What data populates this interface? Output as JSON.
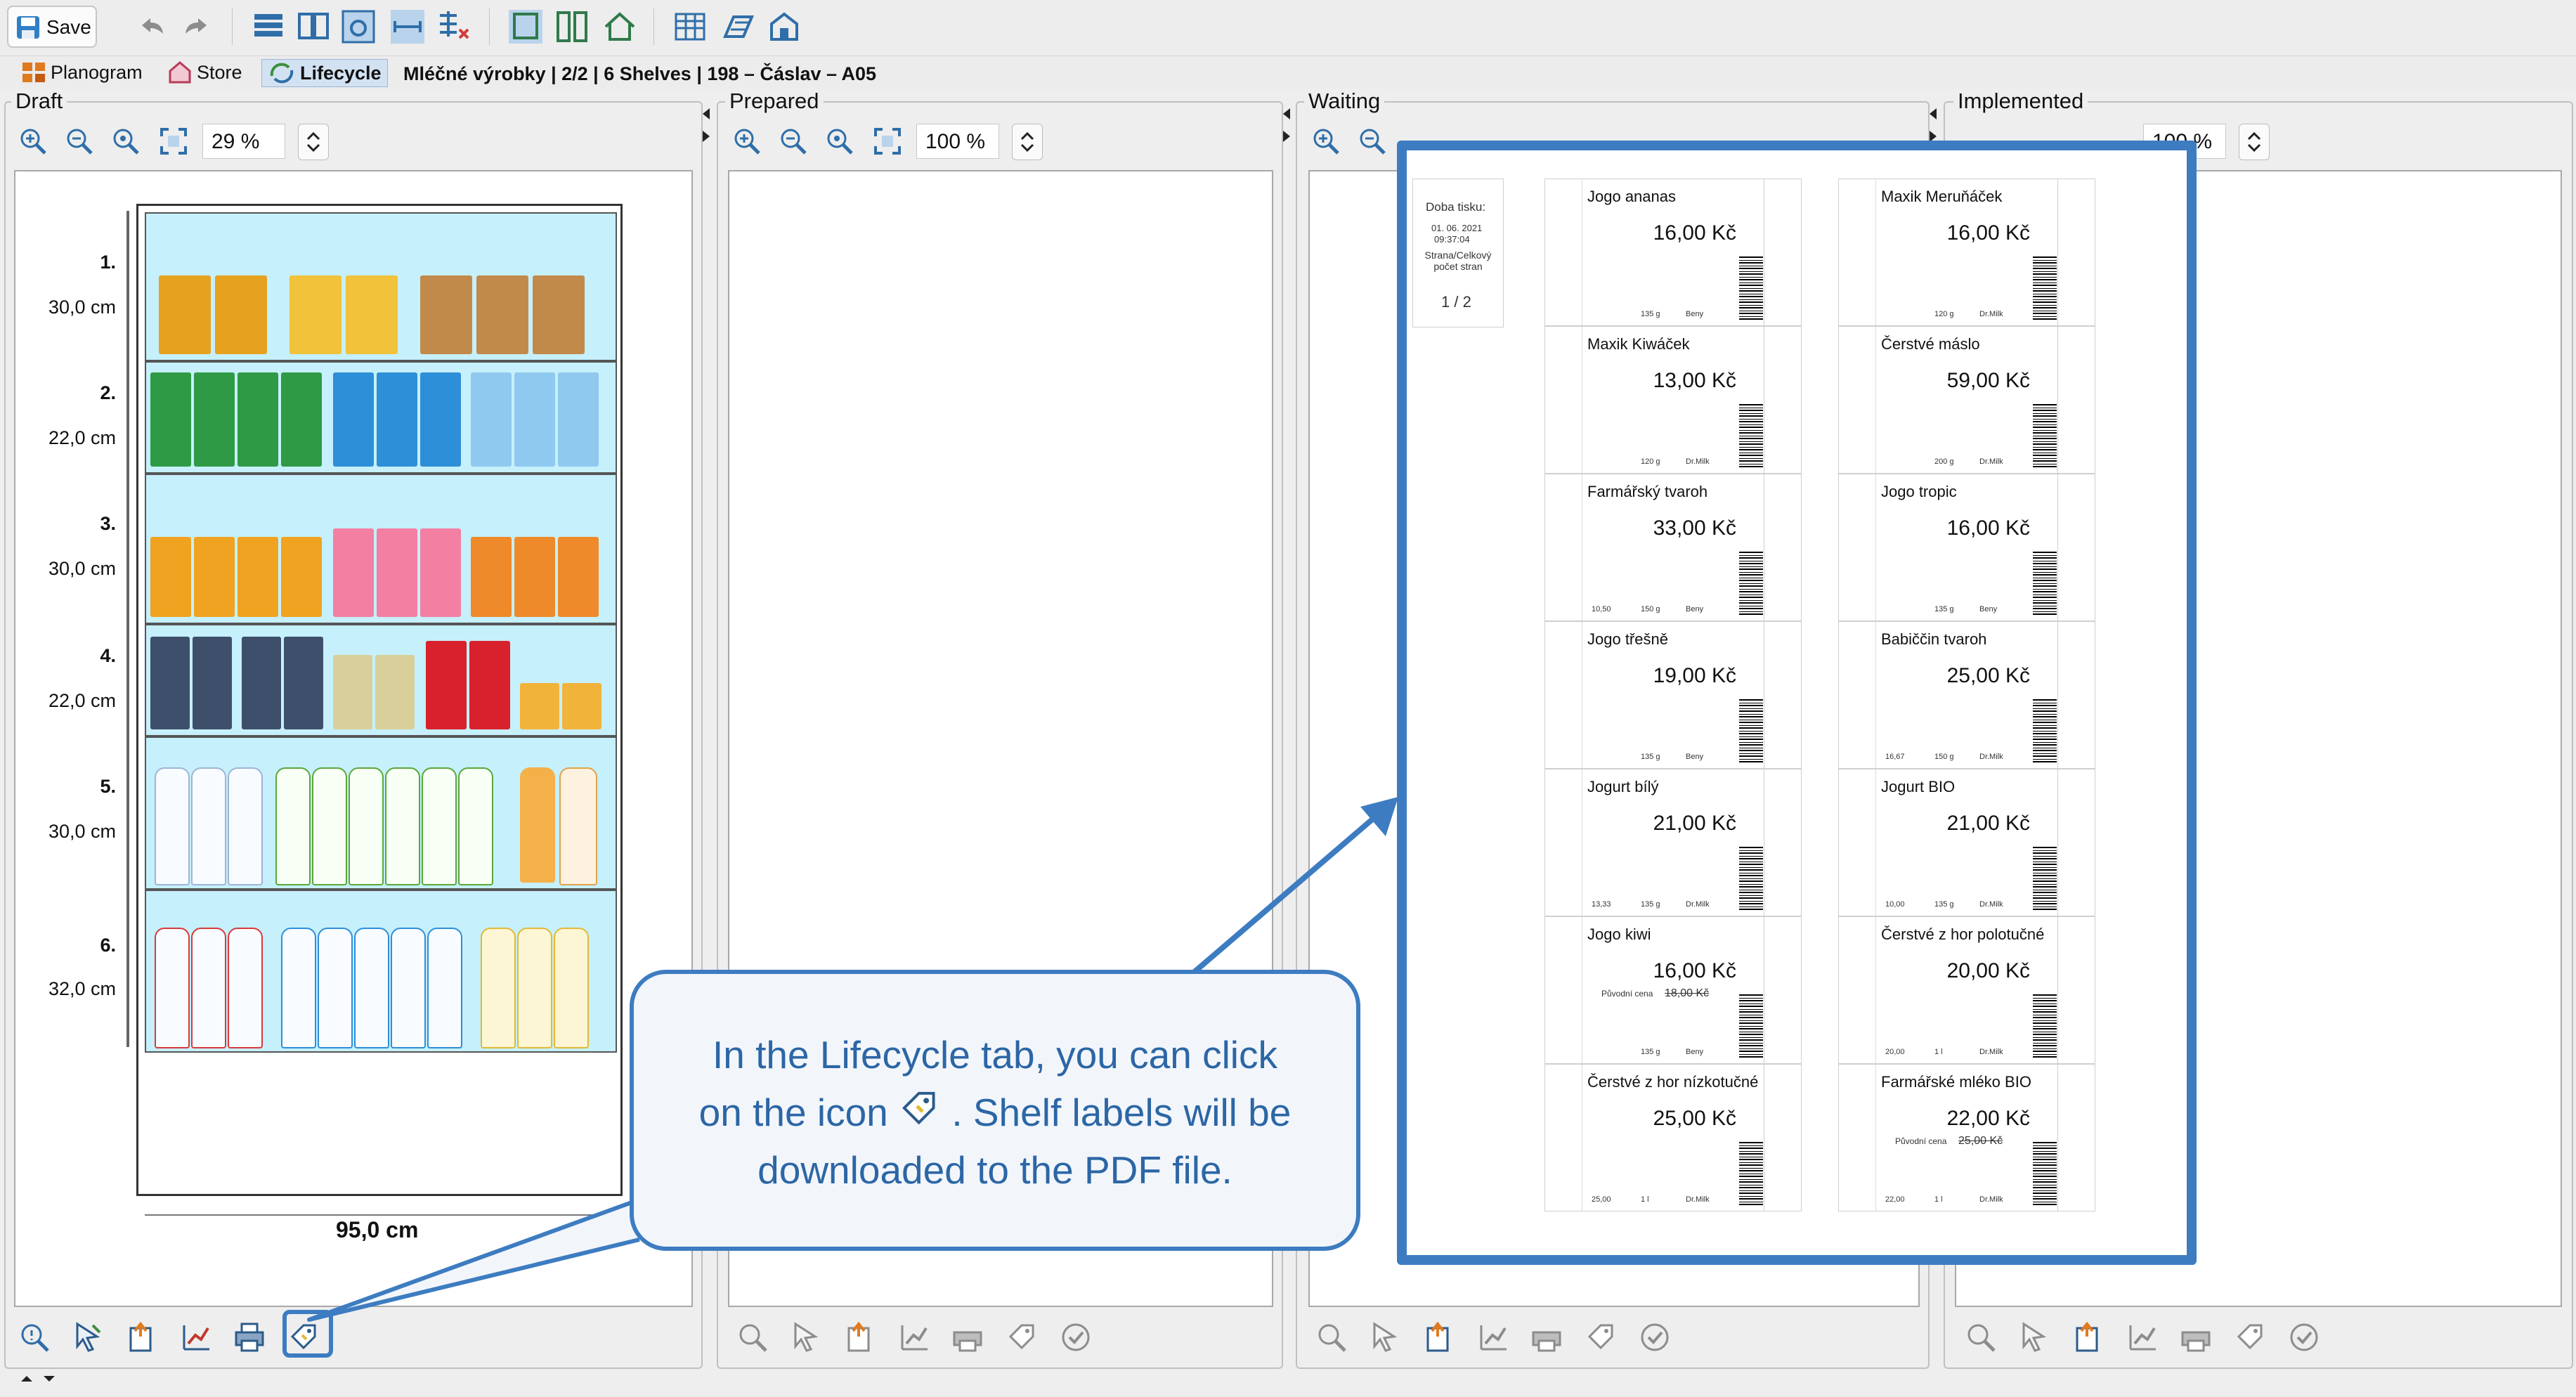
{
  "toolbar": {
    "save_label": "Save",
    "icons": [
      "undo-icon",
      "redo-icon",
      "table-view-icon",
      "book-view-icon",
      "photo-view-icon",
      "dimension-icon",
      "grid-edit-icon",
      "planogram-layout-icon",
      "split-view-icon",
      "store-home-icon",
      "spreadsheet-icon",
      "floor-plan-icon",
      "store-map-icon"
    ]
  },
  "breadcrumb": {
    "planogram": "Planogram",
    "store": "Store",
    "lifecycle": "Lifecycle",
    "path": "Mléčné výrobky | 2/2 | 6 Shelves | 198 – Čáslav – A05"
  },
  "panels": {
    "draft": {
      "title": "Draft",
      "zoom": "29 %"
    },
    "prepared": {
      "title": "Prepared",
      "zoom": "100 %"
    },
    "waiting": {
      "title": "Waiting",
      "zoom": "100 %"
    },
    "implemented": {
      "title": "Implemented",
      "zoom": "100 %"
    }
  },
  "planogram": {
    "shelves": [
      {
        "num": "1.",
        "height": "30,0 cm"
      },
      {
        "num": "2.",
        "height": "22,0 cm"
      },
      {
        "num": "3.",
        "height": "30,0 cm"
      },
      {
        "num": "4.",
        "height": "22,0 cm"
      },
      {
        "num": "5.",
        "height": "30,0 cm"
      },
      {
        "num": "6.",
        "height": "32,0 cm"
      }
    ],
    "width": "95,0 cm"
  },
  "labels": {
    "print_info": {
      "doba_tisku": "Doba tisku:",
      "date": "01. 06. 2021",
      "time": "09:37:04",
      "strana": "Strana/Celkový počet stran",
      "pages": "1 / 2"
    },
    "items": [
      {
        "name": "Jogo ananas",
        "price": "16,00 Kč",
        "weight": "135 g",
        "supplier": "Beny"
      },
      {
        "name": "Maxik Meruňáček",
        "price": "16,00 Kč",
        "weight": "120 g",
        "supplier": "Dr.Milk"
      },
      {
        "name": "Maxik Kiwáček",
        "price": "13,00 Kč",
        "weight": "120 g",
        "supplier": "Dr.Milk"
      },
      {
        "name": "Čerstvé máslo",
        "price": "59,00 Kč",
        "weight": "200 g",
        "supplier": "Dr.Milk"
      },
      {
        "name": "Farmářský tvaroh",
        "price": "33,00 Kč",
        "weight": "150 g",
        "supplier": "Beny",
        "unit_price": "10,50"
      },
      {
        "name": "Jogo tropic",
        "price": "16,00 Kč",
        "weight": "135 g",
        "supplier": "Beny"
      },
      {
        "name": "Jogo třešně",
        "price": "19,00 Kč",
        "weight": "135 g",
        "supplier": "Beny"
      },
      {
        "name": "Babiččin tvaroh",
        "price": "25,00 Kč",
        "weight": "150 g",
        "supplier": "Dr.Milk",
        "unit_price": "16,67"
      },
      {
        "name": "Jogurt bílý",
        "price": "21,00 Kč",
        "weight": "135 g",
        "supplier": "Dr.Milk",
        "unit_price": "13,33"
      },
      {
        "name": "Jogurt BIO",
        "price": "21,00 Kč",
        "weight": "135 g",
        "supplier": "Dr.Milk",
        "unit_price": "10,00"
      },
      {
        "name": "Jogo kiwi",
        "price": "16,00 Kč",
        "weight": "135 g",
        "supplier": "Beny",
        "orig_label": "Původní cena",
        "orig_price": "18,00 Kč"
      },
      {
        "name": "Čerstvé z hor polotučné",
        "price": "20,00 Kč",
        "weight": "1 l",
        "supplier": "Dr.Milk",
        "unit_price": "20,00"
      },
      {
        "name": "Čerstvé z hor nízkotučné",
        "price": "25,00 Kč",
        "weight": "1 l",
        "supplier": "Dr.Milk",
        "unit_price": "25,00"
      },
      {
        "name": "Farmářské mléko BIO",
        "price": "22,00 Kč",
        "weight": "1 l",
        "supplier": "Dr.Milk",
        "unit_price": "22,00",
        "orig_label": "Původní cena",
        "orig_price": "25,00 Kč"
      }
    ]
  },
  "callout": {
    "line1": "In the Lifecycle tab, you can click",
    "line2a": "on the icon",
    "line2b": ". Shelf labels will be",
    "line3": "downloaded to the PDF file."
  },
  "colors": {
    "accent": "#3d7cc1",
    "callout_text": "#2c66a5",
    "shelf_bg": "#c6f0fb"
  }
}
